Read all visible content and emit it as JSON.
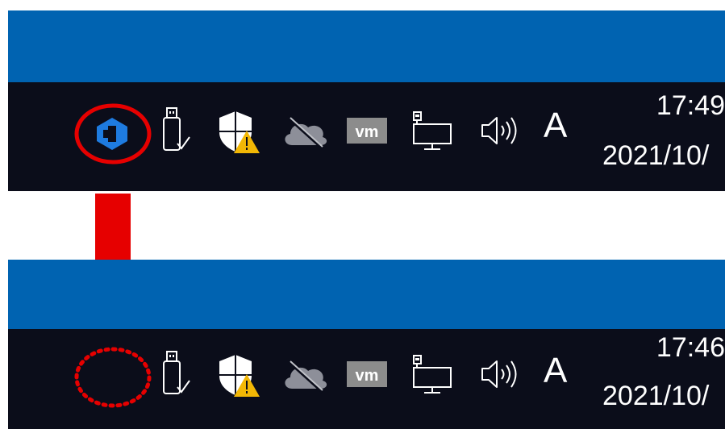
{
  "panels": [
    {
      "state": "before",
      "tray_icons": [
        "app-logo-icon",
        "usb-drive-icon",
        "security-shield-warning-icon",
        "onedrive-offline-icon",
        "vmware-icon",
        "network-icon",
        "volume-icon"
      ],
      "ime_label": "A",
      "clock": {
        "time": "17:49",
        "date": "2021/10/"
      },
      "annotation": "solid-red-circle"
    },
    {
      "state": "after",
      "tray_icons": [
        "usb-drive-icon",
        "security-shield-warning-icon",
        "onedrive-offline-icon",
        "vmware-icon",
        "network-icon",
        "volume-icon"
      ],
      "ime_label": "A",
      "clock": {
        "time": "17:46",
        "date": "2021/10/"
      },
      "annotation": "dotted-red-circle"
    }
  ],
  "arrow_direction": "down",
  "colors": {
    "desktop_blue": "#0063b1",
    "taskbar": "#0b0d1a",
    "annotation_red": "#e60000",
    "app_icon_blue": "#1e7be0"
  }
}
